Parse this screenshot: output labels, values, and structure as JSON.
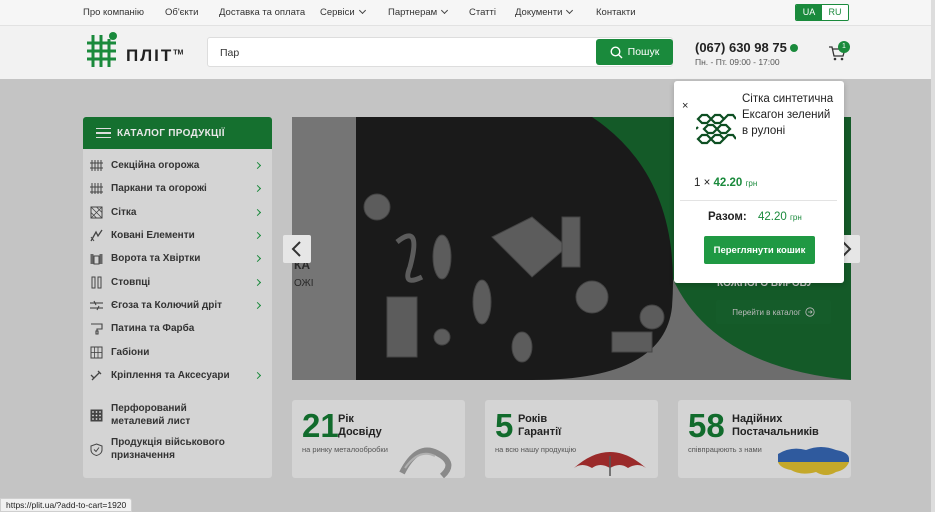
{
  "topnav": {
    "items": [
      {
        "label": "Про компанію",
        "has_dropdown": false
      },
      {
        "label": "Об'єкти",
        "has_dropdown": false
      },
      {
        "label": "Доставка та оплата",
        "has_dropdown": false
      },
      {
        "label": "Сервіси",
        "has_dropdown": true
      },
      {
        "label": "Партнерам",
        "has_dropdown": true
      },
      {
        "label": "Статті",
        "has_dropdown": false
      },
      {
        "label": "Документи",
        "has_dropdown": true
      },
      {
        "label": "Контакти",
        "has_dropdown": false
      }
    ],
    "lang_ua": "UA",
    "lang_ru": "RU",
    "active_lang": "UA"
  },
  "header": {
    "logo_text": "ПЛІТ",
    "logo_tm": "TM",
    "search_value": "Пар",
    "search_button": "Пошук",
    "phone": "(067) 630 98 75",
    "hours": "Пн. - Пт. 09:00 - 17:00",
    "cart_count": "1"
  },
  "catalog": {
    "title": "КАТАЛОГ ПРОДУКЦІЇ",
    "items": [
      {
        "label": "Секційна огорожа",
        "has_sub": true,
        "icon": "fence-icon"
      },
      {
        "label": "Паркани та огорожі",
        "has_sub": true,
        "icon": "fence-icon"
      },
      {
        "label": "Сітка",
        "has_sub": true,
        "icon": "mesh-icon"
      },
      {
        "label": "Ковані Елементи",
        "has_sub": true,
        "icon": "forged-icon"
      },
      {
        "label": "Ворота та Хвіртки",
        "has_sub": true,
        "icon": "gate-icon"
      },
      {
        "label": "Стовпці",
        "has_sub": true,
        "icon": "post-icon"
      },
      {
        "label": "Єгоза та Колючий дріт",
        "has_sub": true,
        "icon": "wire-icon"
      },
      {
        "label": "Патина та Фарба",
        "has_sub": false,
        "icon": "paint-icon"
      },
      {
        "label": "Габіони",
        "has_sub": false,
        "icon": "gabion-icon"
      },
      {
        "label": "Кріплення та Аксесуари",
        "has_sub": true,
        "icon": "fastener-icon"
      },
      {
        "label": "Перфорований металевий лист",
        "has_sub": false,
        "icon": "perforated-icon"
      },
      {
        "label": "Продукція військового призначення",
        "has_sub": false,
        "icon": "shield-icon"
      }
    ]
  },
  "banner": {
    "left_line1": "КА",
    "left_line2": "ОЖІ",
    "right_line1": "КОЖНОГО ВИРОБУ",
    "button": "Перейти в каталог"
  },
  "stats": [
    {
      "number": "21",
      "title": "Рік Досвіду",
      "subtitle": "на ринку металообробки"
    },
    {
      "number": "5",
      "title": "Років Гарантії",
      "subtitle": "на всю нашу продукцію"
    },
    {
      "number": "58",
      "title": "Надійних Постачальників",
      "subtitle": "співпрацюють з нами"
    }
  ],
  "cart_popup": {
    "close": "×",
    "product_name": "Сітка синтетична Ексагон зелений в рулоні",
    "quantity": "1",
    "times": "×",
    "price": "42.20",
    "currency": "грн",
    "total_label": "Разом:",
    "total_price": "42.20",
    "total_currency": "грн",
    "view_cart_button": "Переглянути кошик"
  },
  "status_url": "https://plit.ua/?add-to-cart=1920",
  "colors": {
    "brand_green": "#1a8a3c",
    "dark_green": "#15702f"
  }
}
